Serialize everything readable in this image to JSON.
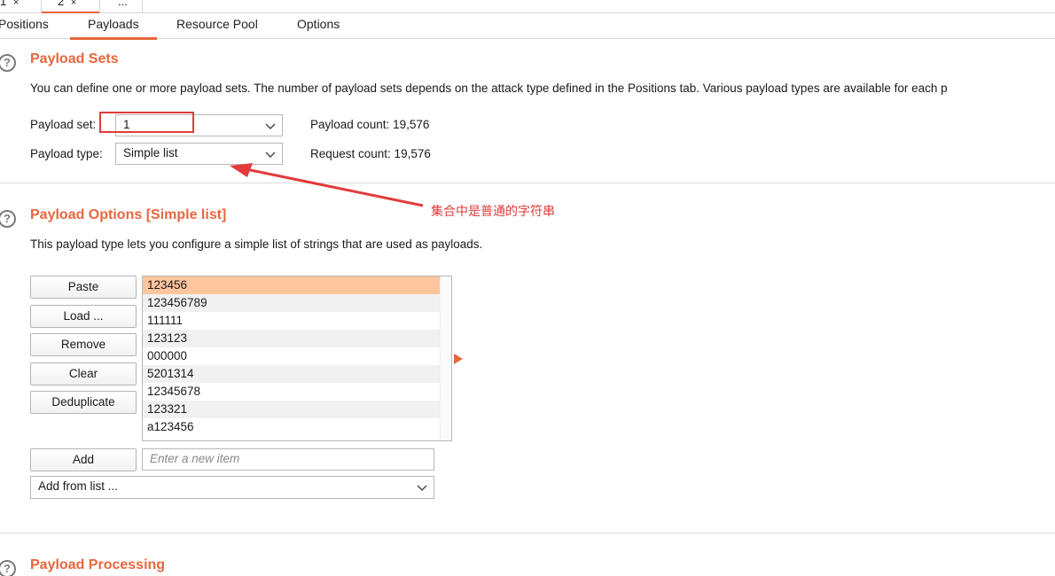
{
  "top_tabs": [
    {
      "label": "1",
      "close": "×"
    },
    {
      "label": "2",
      "close": "×"
    },
    {
      "label": "..."
    }
  ],
  "sub_tabs": [
    "Positions",
    "Payloads",
    "Resource Pool",
    "Options"
  ],
  "payload_sets": {
    "title": "Payload Sets",
    "description": "You can define one or more payload sets. The number of payload sets depends on the attack type defined in the Positions tab. Various payload types are available for each p",
    "set_label": "Payload set:",
    "set_value": "1",
    "type_label": "Payload type:",
    "type_value": "Simple list",
    "payload_count": "Payload count: 19,576",
    "request_count": "Request count: 19,576"
  },
  "payload_options": {
    "title": "Payload Options [Simple list]",
    "description": "This payload type lets you configure a simple list of strings that are used as payloads.",
    "buttons": {
      "paste": "Paste",
      "load": "Load ...",
      "remove": "Remove",
      "clear": "Clear",
      "deduplicate": "Deduplicate",
      "add": "Add"
    },
    "items": [
      "123456",
      "123456789",
      "111111",
      "123123",
      "000000",
      "5201314",
      "12345678",
      "123321",
      "a123456"
    ],
    "new_item_placeholder": "Enter a new item",
    "add_from_list": "Add from list ..."
  },
  "payload_processing": {
    "title": "Payload Processing"
  },
  "annotation": {
    "text": "集合中是普通的字符串"
  },
  "colors": {
    "accent": "#e8663d",
    "annotation": "#e23b3b",
    "selected_row": "#ffc59c"
  }
}
